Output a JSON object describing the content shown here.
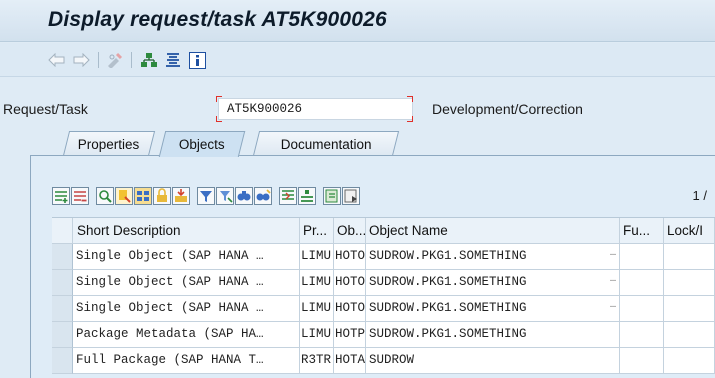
{
  "window": {
    "title": "Display request/task AT5K900026"
  },
  "toolbar": {
    "icons": [
      "back-arrow-icon",
      "forward-arrow-icon",
      "toggle-display-change-icon",
      "hierarchy-icon",
      "list-icon",
      "info-icon"
    ]
  },
  "header": {
    "request_label": "Request/Task",
    "request_value": "AT5K900026",
    "type_label": "Development/Correction"
  },
  "tabs": [
    {
      "label": "Properties",
      "active": false
    },
    {
      "label": "Objects",
      "active": true
    },
    {
      "label": "Documentation",
      "active": false
    }
  ],
  "pager": {
    "text": "1 /"
  },
  "table": {
    "columns": [
      "Short Description",
      "Pr...",
      "Ob...",
      "Object Name",
      "Fu...",
      "Lock/I"
    ],
    "rows": [
      {
        "desc": "Single Object (SAP HANA …",
        "pgmid": "LIMU",
        "obj": "HOTO",
        "name": "SUDROW.PKG1.SOMETHING",
        "more": "…"
      },
      {
        "desc": "Single Object (SAP HANA …",
        "pgmid": "LIMU",
        "obj": "HOTO",
        "name": "SUDROW.PKG1.SOMETHING",
        "more": "…"
      },
      {
        "desc": "Single Object (SAP HANA …",
        "pgmid": "LIMU",
        "obj": "HOTO",
        "name": "SUDROW.PKG1.SOMETHING",
        "more": "…"
      },
      {
        "desc": "Package Metadata (SAP HA…",
        "pgmid": "LIMU",
        "obj": "HOTP",
        "name": "SUDROW.PKG1.SOMETHING",
        "more": ""
      },
      {
        "desc": "Full Package (SAP HANA T…",
        "pgmid": "R3TR",
        "obj": "HOTA",
        "name": "SUDROW",
        "more": ""
      }
    ]
  },
  "colors": {
    "accent": "#0a6ed1",
    "required_marker": "#e0302a",
    "background": "#dfebf5"
  }
}
